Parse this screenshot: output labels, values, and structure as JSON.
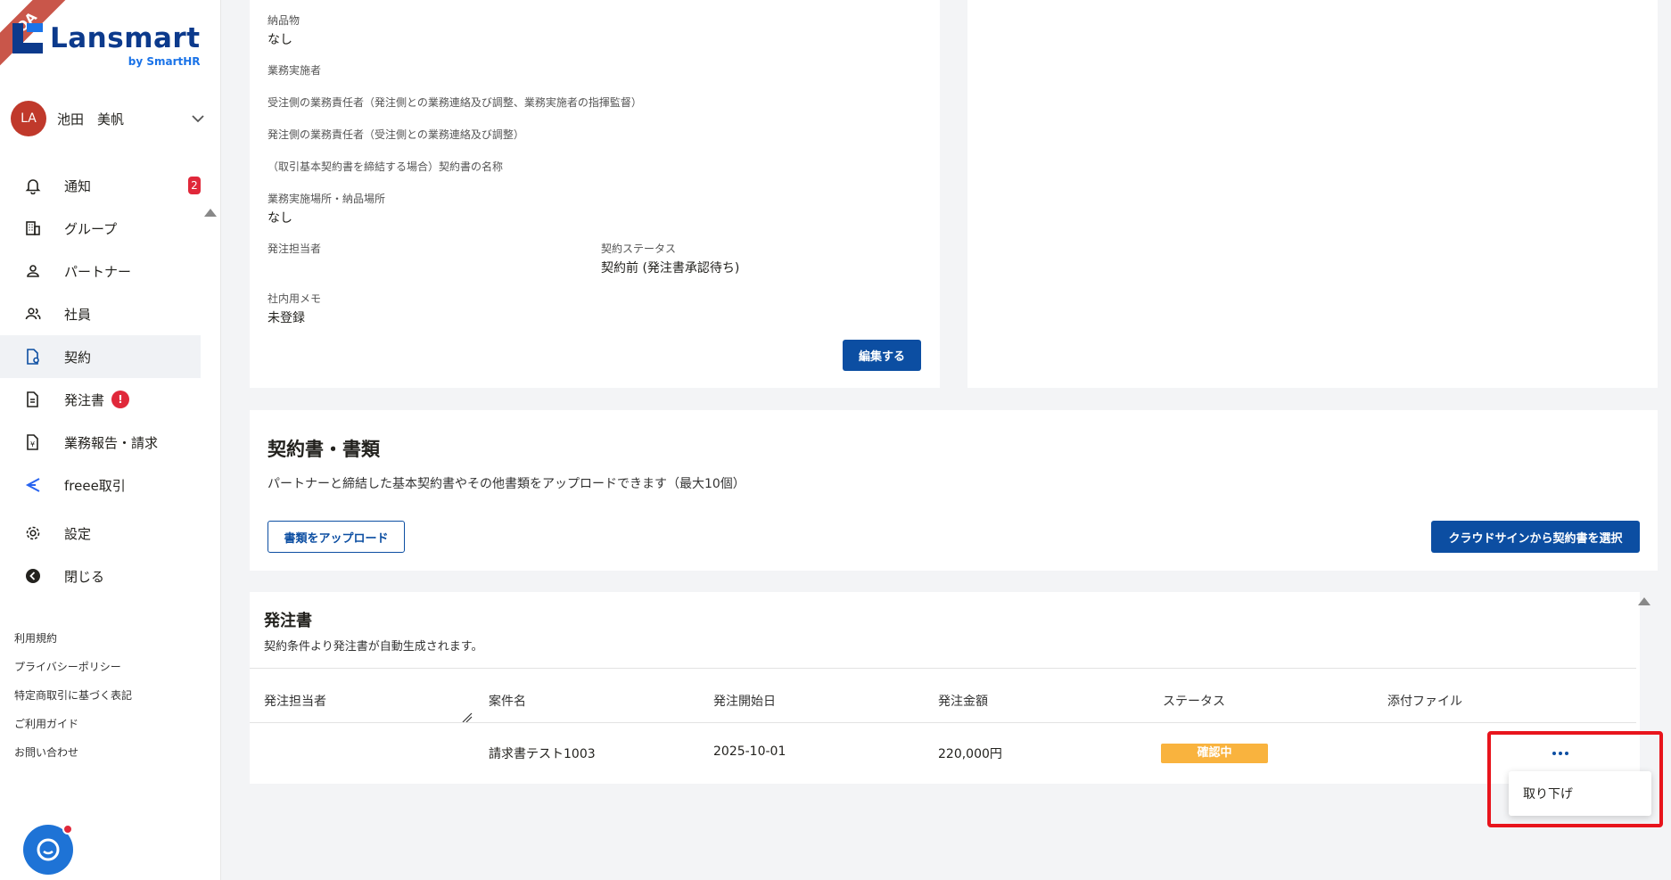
{
  "sidebar": {
    "ribbon": "QA",
    "logo": {
      "name": "Lansmart",
      "sub": "by SmartHR"
    },
    "user": {
      "initials": "LA",
      "name": "池田　美帆"
    },
    "nav": [
      {
        "label": "通知",
        "icon": "bell-icon",
        "badge": "2"
      },
      {
        "label": "グループ",
        "icon": "building-icon"
      },
      {
        "label": "パートナー",
        "icon": "person-icon"
      },
      {
        "label": "社員",
        "icon": "people-icon"
      },
      {
        "label": "契約",
        "icon": "contract-icon",
        "active": true
      },
      {
        "label": "発注書",
        "icon": "document-icon",
        "badge": "!"
      },
      {
        "label": "業務報告・請求",
        "icon": "invoice-icon"
      },
      {
        "label": "freee取引",
        "icon": "freee-icon"
      },
      {
        "label": "設定",
        "icon": "gear-icon"
      },
      {
        "label": "閉じる",
        "icon": "collapse-icon"
      }
    ],
    "footer_links": [
      "利用規約",
      "プライバシーポリシー",
      "特定商取引に基づく表記",
      "ご利用ガイド",
      "お問い合わせ"
    ]
  },
  "contract_details": {
    "deliverables_label": "納品物",
    "deliverables_value": "なし",
    "implementer_label": "業務実施者",
    "receiver_manager_label": "受注側の業務責任者（発注側との業務連絡及び調整、業務実施者の指揮監督）",
    "orderer_manager_label": "発注側の業務責任者（受注側との業務連絡及び調整）",
    "master_contract_label": "（取引基本契約書を締結する場合）契約書の名称",
    "location_label": "業務実施場所・納品場所",
    "location_value": "なし",
    "order_owner_label": "発注担当者",
    "status_label": "契約ステータス",
    "status_value": "契約前 (発注書承認待ち)",
    "memo_label": "社内用メモ",
    "memo_value": "未登録",
    "edit_button": "編集する"
  },
  "documents": {
    "title": "契約書・書類",
    "description": "パートナーと締結した基本契約書やその他書類をアップロードできます（最大10個）",
    "upload_button": "書類をアップロード",
    "cloudsign_button": "クラウドサインから契約書を選択"
  },
  "purchase_orders": {
    "title": "発注書",
    "subtitle": "契約条件より発注書が自動生成されます。",
    "columns": [
      "発注担当者",
      "案件名",
      "発注開始日",
      "発注金額",
      "ステータス",
      "添付ファイル"
    ],
    "rows": [
      {
        "owner": "",
        "name": "請求書テスト1003",
        "start_date": "2025-10-01",
        "amount": "220,000円",
        "status": "確認中",
        "attachment": ""
      }
    ],
    "menu": {
      "withdraw": "取り下げ"
    }
  },
  "colors": {
    "primary": "#0c4ea2",
    "status_pending": "#f9b33e",
    "alert": "#e0283a",
    "highlight": "#e8141c"
  }
}
